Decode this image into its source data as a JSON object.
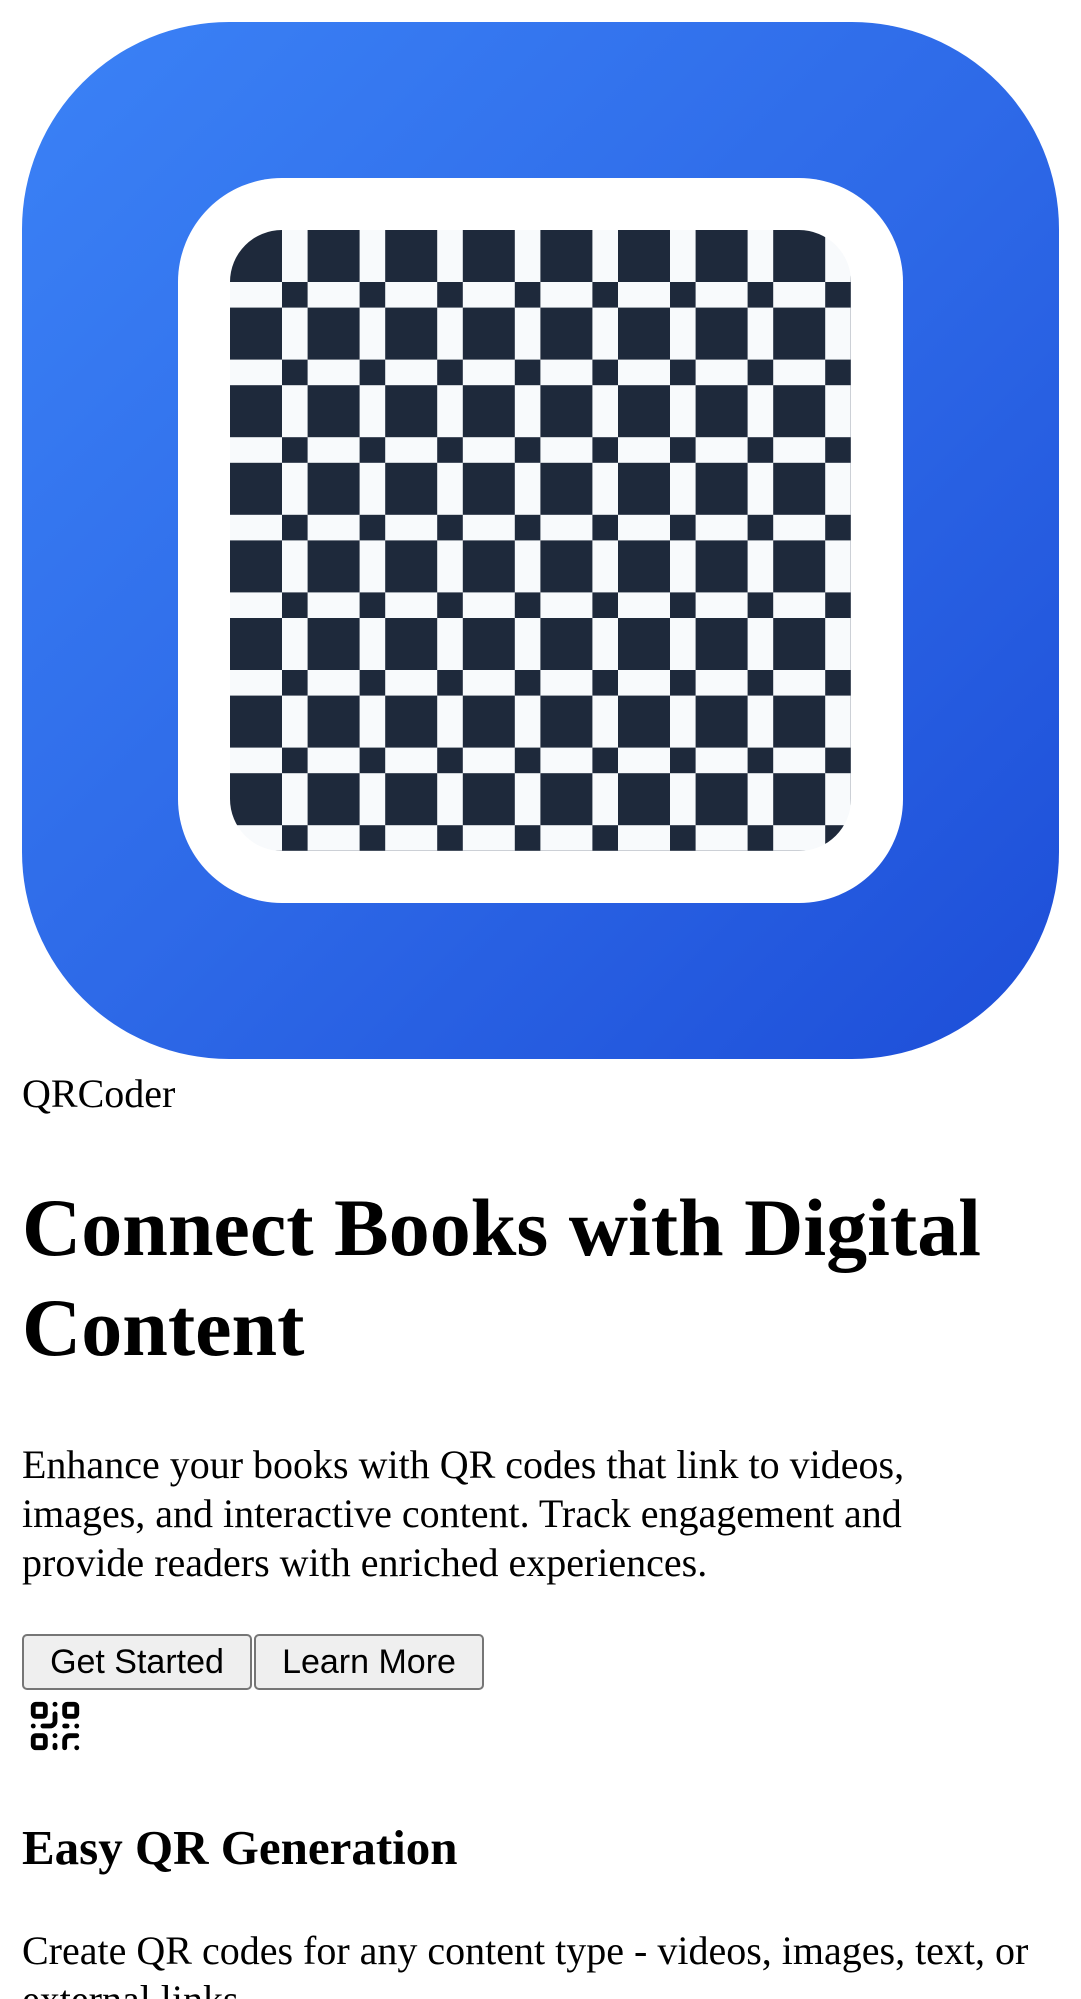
{
  "brand": {
    "name": "QRCoder",
    "logo_icon": "qr-code-logo-icon",
    "gradient_start": "#3b82f6",
    "gradient_end": "#1d4ed8",
    "pattern_dark": "#1e293b",
    "pattern_light": "#f8fafc"
  },
  "hero": {
    "title": "Connect Books with Digital Content",
    "description": "Enhance your books with QR codes that link to videos, images, and interactive content. Track engagement and provide readers with enriched experiences.",
    "primary_button": "Get Started",
    "secondary_button": "Learn More"
  },
  "features": [
    {
      "icon": "qr-code-icon",
      "title": "Easy QR Generation",
      "description": "Create QR codes for any content type - videos, images, text, or external links."
    }
  ]
}
